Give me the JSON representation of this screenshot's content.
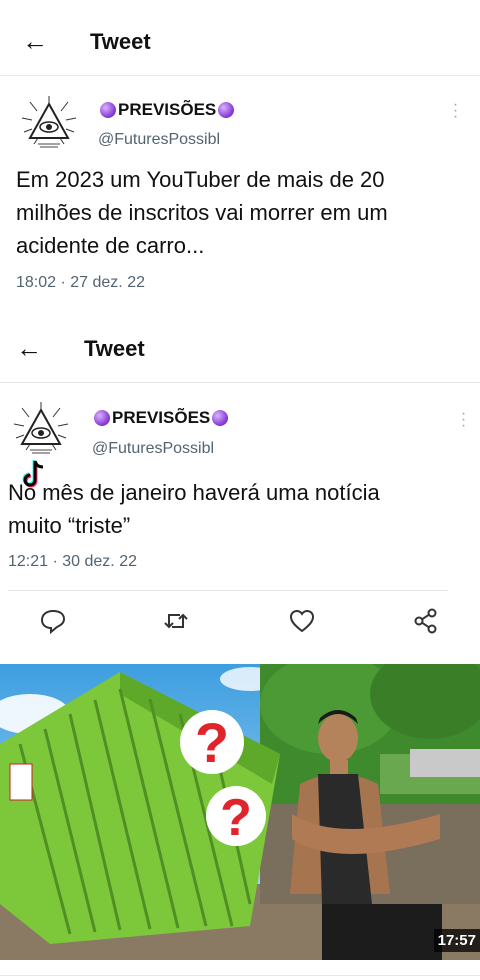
{
  "screen1": {
    "header_title": "Tweet",
    "author_name": "PREVISÕES",
    "author_handle": "@FuturesPossibl",
    "tweet_text": "Em 2023 um YouTuber de mais de 20 milhões de inscritos vai  morrer em um acidente de carro...",
    "timestamp": "18:02 · 27 dez. 22"
  },
  "screen2": {
    "header_title": "Tweet",
    "author_name": "PREVISÕES",
    "author_handle": "@FuturesPossibl",
    "tweet_text": "No mês de janeiro haverá uma notícia muito “triste”",
    "timestamp": "12:21 · 30 dez. 22"
  },
  "media": {
    "duration": "17:57"
  },
  "icons": {
    "back": "arrow-left-icon",
    "more": "more-vertical-icon",
    "reply": "reply-icon",
    "retweet": "retweet-icon",
    "like": "heart-icon",
    "share": "share-icon"
  },
  "colors": {
    "text": "#0f1419",
    "secondary": "#536471",
    "container_green": "#7cc73a",
    "question_red": "#e0242c"
  }
}
